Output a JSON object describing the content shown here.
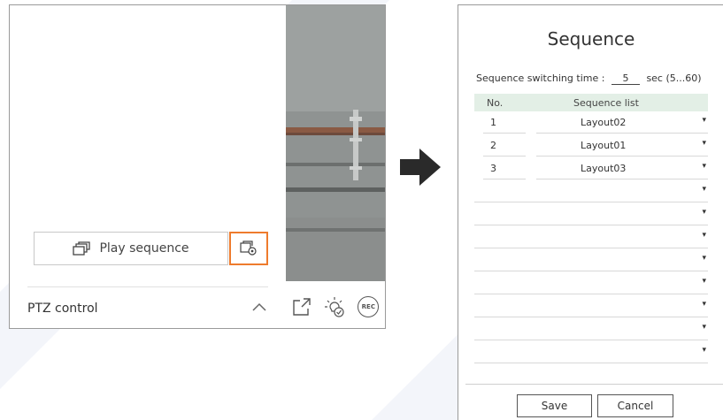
{
  "left_panel": {
    "play_sequence_label": "Play sequence",
    "ptz_label": "PTZ control",
    "icons": [
      "layers-icon",
      "sequence-settings-icon",
      "chevron-up-icon",
      "popout-icon",
      "light-check-icon",
      "rec-icon"
    ],
    "rec_label": "REC",
    "accent_color": "#ee7b2d"
  },
  "dialog": {
    "title": "Sequence",
    "switching_label": "Sequence switching time :",
    "switching_value": "5",
    "switching_unit": "sec (5...60)",
    "col_no": "No.",
    "col_list": "Sequence list",
    "rows": [
      {
        "no": "1",
        "value": "Layout02"
      },
      {
        "no": "2",
        "value": "Layout01"
      },
      {
        "no": "3",
        "value": "Layout03"
      },
      {
        "no": "",
        "value": ""
      },
      {
        "no": "",
        "value": ""
      },
      {
        "no": "",
        "value": ""
      },
      {
        "no": "",
        "value": ""
      },
      {
        "no": "",
        "value": ""
      },
      {
        "no": "",
        "value": ""
      },
      {
        "no": "",
        "value": ""
      },
      {
        "no": "",
        "value": ""
      }
    ],
    "save_label": "Save",
    "cancel_label": "Cancel",
    "header_color": "#e3efe6"
  }
}
